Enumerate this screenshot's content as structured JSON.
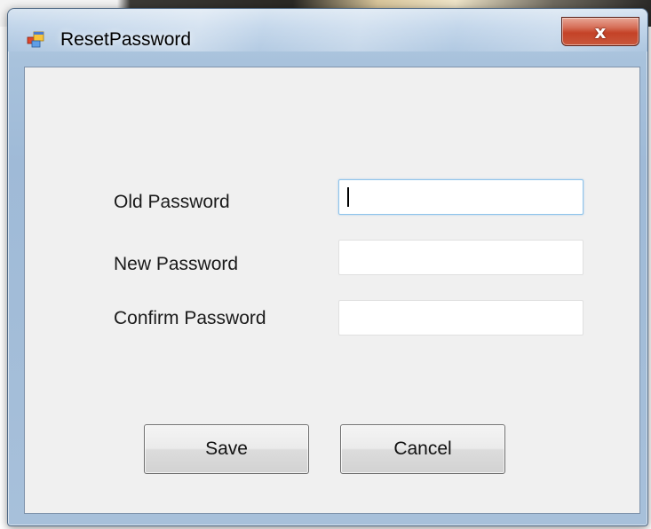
{
  "window": {
    "title": "ResetPassword",
    "app_icon": "windows-form-icon",
    "close_glyph": "x",
    "close_icon": "close-icon"
  },
  "form": {
    "old_password": {
      "label": "Old Password",
      "value": ""
    },
    "new_password": {
      "label": "New Password",
      "value": ""
    },
    "confirm_password": {
      "label": "Confirm Password",
      "value": ""
    }
  },
  "buttons": {
    "save_label": "Save",
    "cancel_label": "Cancel"
  },
  "colors": {
    "dialog_background": "#f0f0f0",
    "close_button": "#c44227",
    "focused_field_border": "#8ec3eb"
  }
}
